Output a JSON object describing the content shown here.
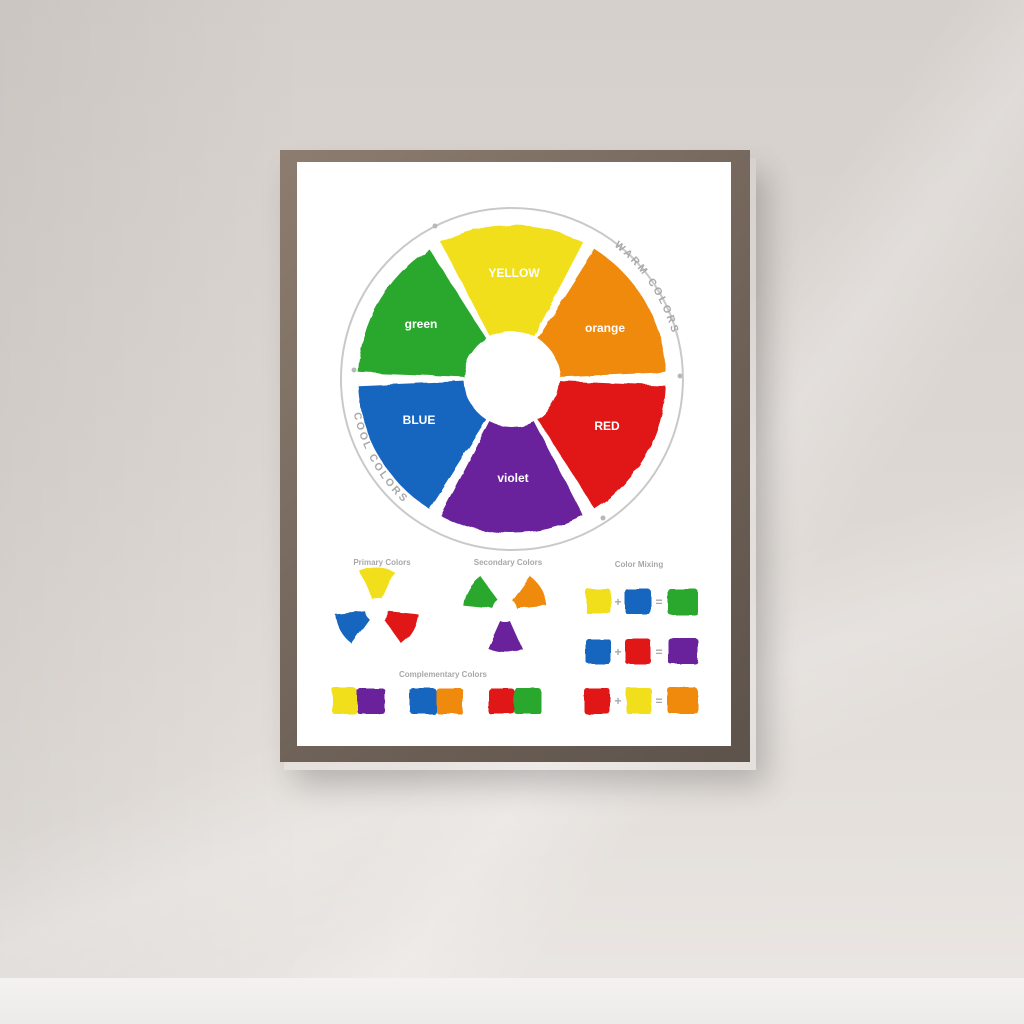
{
  "wheel": {
    "segments": [
      {
        "label": "YELLOW",
        "color": "#f2df1a"
      },
      {
        "label": "orange",
        "color": "#f08a0f"
      },
      {
        "label": "RED",
        "color": "#e11818"
      },
      {
        "label": "violet",
        "color": "#6a249c"
      },
      {
        "label": "BLUE",
        "color": "#1866c0"
      },
      {
        "label": "green",
        "color": "#2aa82e"
      }
    ],
    "warm_label": "WARM COLORS",
    "cool_label": "COOL COLORS"
  },
  "primary": {
    "title": "Primary Colors"
  },
  "secondary": {
    "title": "Secondary Colors"
  },
  "complementary": {
    "title": "Complementary Colors"
  },
  "mixing": {
    "title": "Color Mixing",
    "plus": "+",
    "equals": "="
  },
  "colors": {
    "yellow": "#f2df1a",
    "orange": "#f08a0f",
    "red": "#e11818",
    "violet": "#6a249c",
    "blue": "#1866c0",
    "green": "#2aa82e",
    "label_gray": "#a8a8a8"
  }
}
